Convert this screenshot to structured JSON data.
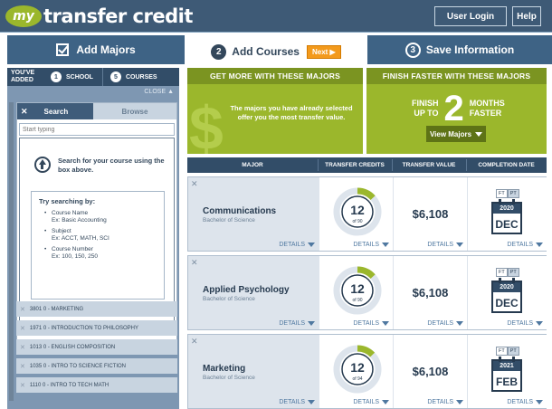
{
  "header": {
    "logo_badge": "my",
    "logo_text": "transfer credit",
    "user_login": "User Login",
    "help": "Help"
  },
  "steps": [
    {
      "label": "Add Majors",
      "state": "done"
    },
    {
      "number": "2",
      "label": "Add Courses",
      "next": "Next ▶",
      "state": "active"
    },
    {
      "number": "3",
      "label": "Save Information",
      "state": "pending"
    }
  ],
  "added": {
    "label": "YOU'VE ADDED",
    "school_count": "1",
    "school_label": "SCHOOL",
    "course_count": "5",
    "course_label": "COURSES",
    "close": "CLOSE ▲"
  },
  "search": {
    "tab_search": "Search",
    "tab_browse": "Browse",
    "placeholder": "Start typing",
    "hint": "Search for your course using the box above.",
    "try_title": "Try searching by:",
    "try_items": [
      {
        "label": "Course Name",
        "example": "Ex: Basic Accounting"
      },
      {
        "label": "Subject",
        "example": "Ex: ACCT, MATH, SCI"
      },
      {
        "label": "Course Number",
        "example": "Ex: 100, 150, 250"
      }
    ]
  },
  "courses": [
    "3801 0 - MARKETING",
    "1971 0 - INTRODUCTION TO PHILOSOPHY",
    "1013 0 - ENGLISH COMPOSITION",
    "1035 0 - INTRO TO SCIENCE FICTION",
    "1110 0 - INTRO TO TECH MATH"
  ],
  "promo1": {
    "title": "GET MORE WITH THESE MAJORS",
    "text": "The majors you have already selected offer you the most transfer value."
  },
  "promo2": {
    "title": "FINISH FASTER WITH THESE MAJORS",
    "finish_line1": "FINISH",
    "finish_line2": "UP TO",
    "big_number": "2",
    "months_line1": "MONTHS",
    "months_line2": "FASTER",
    "view_majors": "View Majors"
  },
  "table": {
    "headers": [
      "MAJOR",
      "TRANSFER CREDITS",
      "TRANSFER VALUE",
      "COMPLETION DATE"
    ],
    "details_label": "DETAILS",
    "rows": [
      {
        "major": "Communications",
        "degree": "Bachelor of Science",
        "credits": "12",
        "credits_of": "of 90",
        "credits_fraction": 0.133,
        "value": "$6,108",
        "ft": "FT",
        "pt": "PT",
        "year": "2020",
        "month": "DEC"
      },
      {
        "major": "Applied Psychology",
        "degree": "Bachelor of Science",
        "credits": "12",
        "credits_of": "of 90",
        "credits_fraction": 0.133,
        "value": "$6,108",
        "ft": "FT",
        "pt": "PT",
        "year": "2020",
        "month": "DEC"
      },
      {
        "major": "Marketing",
        "degree": "Bachelor of Science",
        "credits": "12",
        "credits_of": "of 94",
        "credits_fraction": 0.128,
        "value": "$6,108",
        "ft": "FT",
        "pt": "PT",
        "year": "2021",
        "month": "FEB"
      }
    ]
  },
  "colors": {
    "brand_green": "#9bb72c",
    "navy": "#324d68",
    "step_blue": "#3e6385",
    "next_orange": "#f39a1c"
  }
}
